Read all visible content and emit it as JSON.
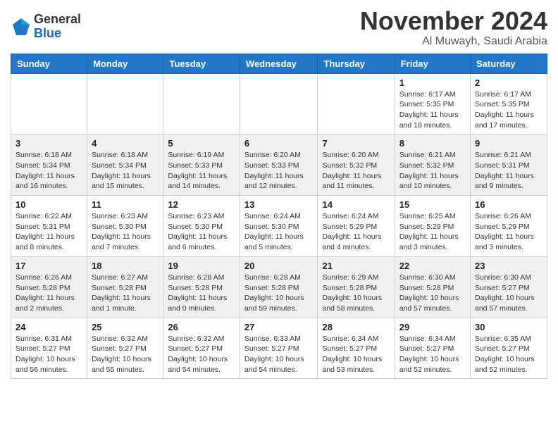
{
  "header": {
    "logo_general": "General",
    "logo_blue": "Blue",
    "month_title": "November 2024",
    "location": "Al Muwayh, Saudi Arabia"
  },
  "calendar": {
    "days_of_week": [
      "Sunday",
      "Monday",
      "Tuesday",
      "Wednesday",
      "Thursday",
      "Friday",
      "Saturday"
    ],
    "weeks": [
      [
        {
          "day": "",
          "info": ""
        },
        {
          "day": "",
          "info": ""
        },
        {
          "day": "",
          "info": ""
        },
        {
          "day": "",
          "info": ""
        },
        {
          "day": "",
          "info": ""
        },
        {
          "day": "1",
          "info": "Sunrise: 6:17 AM\nSunset: 5:35 PM\nDaylight: 11 hours and 18 minutes."
        },
        {
          "day": "2",
          "info": "Sunrise: 6:17 AM\nSunset: 5:35 PM\nDaylight: 11 hours and 17 minutes."
        }
      ],
      [
        {
          "day": "3",
          "info": "Sunrise: 6:18 AM\nSunset: 5:34 PM\nDaylight: 11 hours and 16 minutes."
        },
        {
          "day": "4",
          "info": "Sunrise: 6:18 AM\nSunset: 5:34 PM\nDaylight: 11 hours and 15 minutes."
        },
        {
          "day": "5",
          "info": "Sunrise: 6:19 AM\nSunset: 5:33 PM\nDaylight: 11 hours and 14 minutes."
        },
        {
          "day": "6",
          "info": "Sunrise: 6:20 AM\nSunset: 5:33 PM\nDaylight: 11 hours and 12 minutes."
        },
        {
          "day": "7",
          "info": "Sunrise: 6:20 AM\nSunset: 5:32 PM\nDaylight: 11 hours and 11 minutes."
        },
        {
          "day": "8",
          "info": "Sunrise: 6:21 AM\nSunset: 5:32 PM\nDaylight: 11 hours and 10 minutes."
        },
        {
          "day": "9",
          "info": "Sunrise: 6:21 AM\nSunset: 5:31 PM\nDaylight: 11 hours and 9 minutes."
        }
      ],
      [
        {
          "day": "10",
          "info": "Sunrise: 6:22 AM\nSunset: 5:31 PM\nDaylight: 11 hours and 8 minutes."
        },
        {
          "day": "11",
          "info": "Sunrise: 6:23 AM\nSunset: 5:30 PM\nDaylight: 11 hours and 7 minutes."
        },
        {
          "day": "12",
          "info": "Sunrise: 6:23 AM\nSunset: 5:30 PM\nDaylight: 11 hours and 6 minutes."
        },
        {
          "day": "13",
          "info": "Sunrise: 6:24 AM\nSunset: 5:30 PM\nDaylight: 11 hours and 5 minutes."
        },
        {
          "day": "14",
          "info": "Sunrise: 6:24 AM\nSunset: 5:29 PM\nDaylight: 11 hours and 4 minutes."
        },
        {
          "day": "15",
          "info": "Sunrise: 6:25 AM\nSunset: 5:29 PM\nDaylight: 11 hours and 3 minutes."
        },
        {
          "day": "16",
          "info": "Sunrise: 6:26 AM\nSunset: 5:29 PM\nDaylight: 11 hours and 3 minutes."
        }
      ],
      [
        {
          "day": "17",
          "info": "Sunrise: 6:26 AM\nSunset: 5:28 PM\nDaylight: 11 hours and 2 minutes."
        },
        {
          "day": "18",
          "info": "Sunrise: 6:27 AM\nSunset: 5:28 PM\nDaylight: 11 hours and 1 minute."
        },
        {
          "day": "19",
          "info": "Sunrise: 6:28 AM\nSunset: 5:28 PM\nDaylight: 11 hours and 0 minutes."
        },
        {
          "day": "20",
          "info": "Sunrise: 6:28 AM\nSunset: 5:28 PM\nDaylight: 10 hours and 59 minutes."
        },
        {
          "day": "21",
          "info": "Sunrise: 6:29 AM\nSunset: 5:28 PM\nDaylight: 10 hours and 58 minutes."
        },
        {
          "day": "22",
          "info": "Sunrise: 6:30 AM\nSunset: 5:28 PM\nDaylight: 10 hours and 57 minutes."
        },
        {
          "day": "23",
          "info": "Sunrise: 6:30 AM\nSunset: 5:27 PM\nDaylight: 10 hours and 57 minutes."
        }
      ],
      [
        {
          "day": "24",
          "info": "Sunrise: 6:31 AM\nSunset: 5:27 PM\nDaylight: 10 hours and 56 minutes."
        },
        {
          "day": "25",
          "info": "Sunrise: 6:32 AM\nSunset: 5:27 PM\nDaylight: 10 hours and 55 minutes."
        },
        {
          "day": "26",
          "info": "Sunrise: 6:32 AM\nSunset: 5:27 PM\nDaylight: 10 hours and 54 minutes."
        },
        {
          "day": "27",
          "info": "Sunrise: 6:33 AM\nSunset: 5:27 PM\nDaylight: 10 hours and 54 minutes."
        },
        {
          "day": "28",
          "info": "Sunrise: 6:34 AM\nSunset: 5:27 PM\nDaylight: 10 hours and 53 minutes."
        },
        {
          "day": "29",
          "info": "Sunrise: 6:34 AM\nSunset: 5:27 PM\nDaylight: 10 hours and 52 minutes."
        },
        {
          "day": "30",
          "info": "Sunrise: 6:35 AM\nSunset: 5:27 PM\nDaylight: 10 hours and 52 minutes."
        }
      ]
    ]
  }
}
